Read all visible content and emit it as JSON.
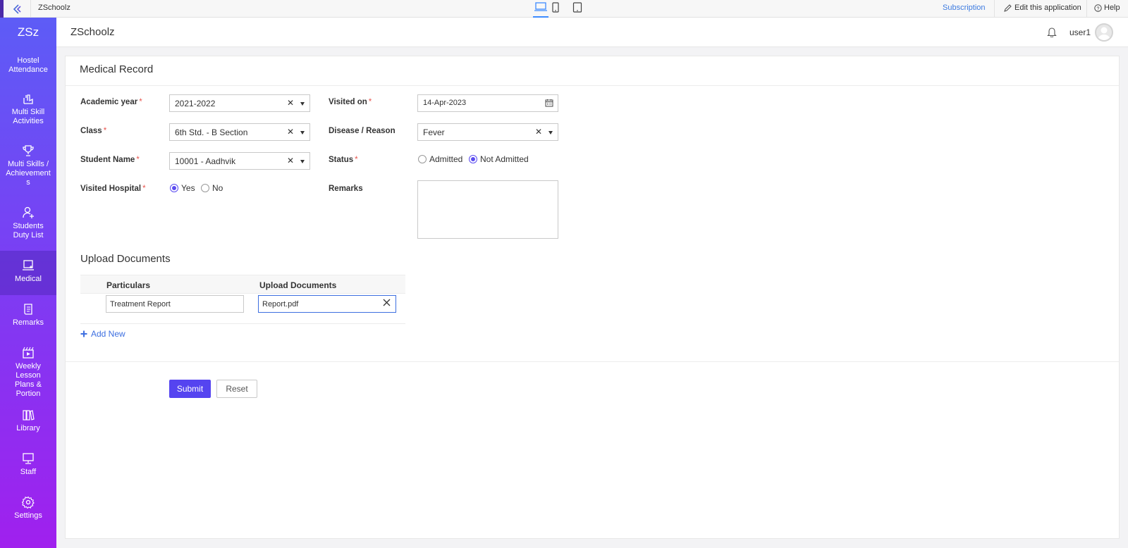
{
  "topbar": {
    "app_name": "ZSchoolz",
    "subscription": "Subscription",
    "edit_app": "Edit this application",
    "help": "Help"
  },
  "sidebar": {
    "logo": "ZSz",
    "items": [
      {
        "label": "Hostel Attendance",
        "icon": "none"
      },
      {
        "label": "Multi Skill Activities",
        "icon": "hand-icon"
      },
      {
        "label": "Multi Skills / Achievements",
        "icon": "trophy-icon"
      },
      {
        "label": "Students Duty List",
        "icon": "user-add-icon"
      },
      {
        "label": "Medical",
        "icon": "medical-icon",
        "active": true
      },
      {
        "label": "Remarks",
        "icon": "scroll-icon"
      },
      {
        "label": "Weekly Lesson Plans & Portion",
        "icon": "clapper-icon"
      },
      {
        "label": "Library",
        "icon": "books-icon"
      },
      {
        "label": "Staff",
        "icon": "monitor-icon"
      },
      {
        "label": "Settings",
        "icon": "gear-icon"
      }
    ]
  },
  "header": {
    "title": "ZSchoolz",
    "user": "user1"
  },
  "form": {
    "title": "Medical Record",
    "academic_year": {
      "label": "Academic year",
      "value": "2021-2022"
    },
    "class": {
      "label": "Class",
      "value": "6th Std. - B Section"
    },
    "student_name": {
      "label": "Student Name",
      "value": "10001 - Aadhvik"
    },
    "visited_hospital": {
      "label": "Visited Hospital",
      "options": [
        "Yes",
        "No"
      ],
      "selected": "Yes"
    },
    "visited_on": {
      "label": "Visited on",
      "value": "14-Apr-2023"
    },
    "disease": {
      "label": "Disease / Reason",
      "value": "Fever"
    },
    "status": {
      "label": "Status",
      "options": [
        "Admitted",
        "Not Admitted"
      ],
      "selected": "Not Admitted"
    },
    "remarks": {
      "label": "Remarks",
      "value": ""
    },
    "required_mark": "*"
  },
  "upload": {
    "title": "Upload Documents",
    "col_particulars": "Particulars",
    "col_upload": "Upload Documents",
    "row": {
      "particulars": "Treatment Report",
      "file": "Report.pdf"
    },
    "add_new": "Add New"
  },
  "actions": {
    "submit": "Submit",
    "reset": "Reset"
  },
  "colors": {
    "accent": "#5544f0",
    "sidebar_top": "#5d5cf6",
    "sidebar_bottom": "#a020ee",
    "link": "#3d6fe0",
    "required": "#e8554e"
  }
}
